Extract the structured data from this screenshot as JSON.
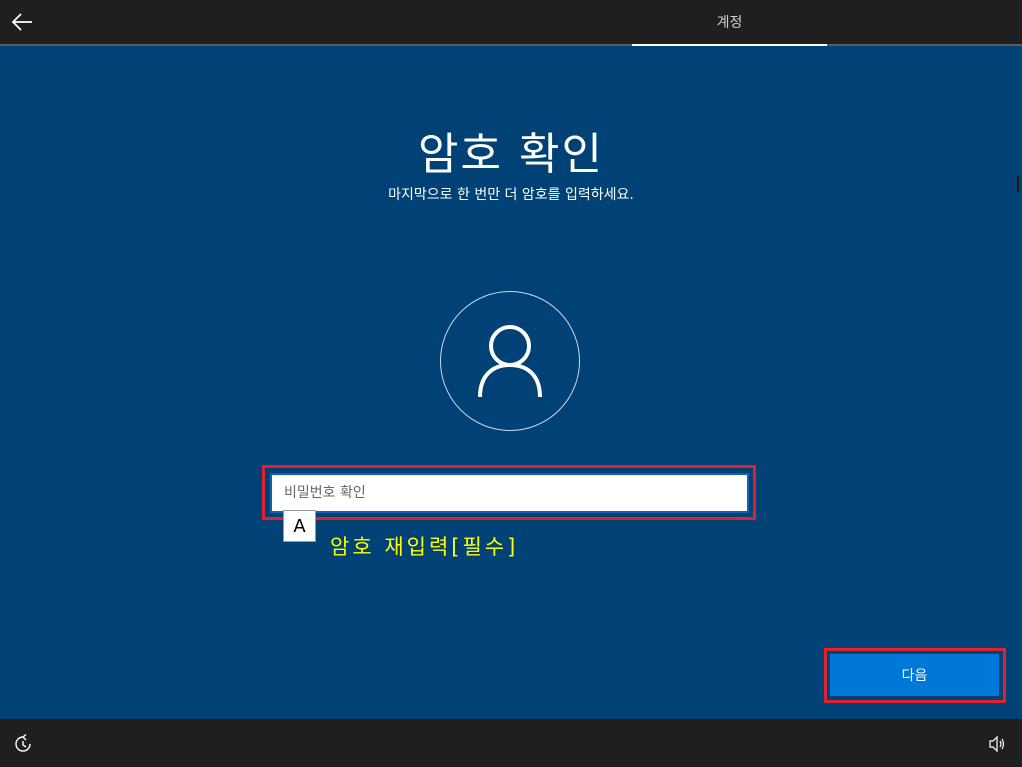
{
  "header": {
    "back_icon": "arrow-left-icon",
    "tab_label": "계정"
  },
  "main": {
    "title": "암호 확인",
    "subtitle": "마지막으로 한 번만 더 암호를 입력하세요.",
    "avatar_icon": "user-icon",
    "password": {
      "placeholder": "비밀번호 확인",
      "value": ""
    },
    "key_label": "A",
    "annotation": "암호 재입력[필수]",
    "next_label": "다음"
  },
  "footer": {
    "ease_icon": "ease-of-access-icon",
    "volume_icon": "volume-icon"
  },
  "colors": {
    "background": "#004275",
    "bar": "#1f1f1f",
    "accent": "#0078d7",
    "highlight_border": "#e3202d",
    "annotation_text": "#ffff00"
  }
}
